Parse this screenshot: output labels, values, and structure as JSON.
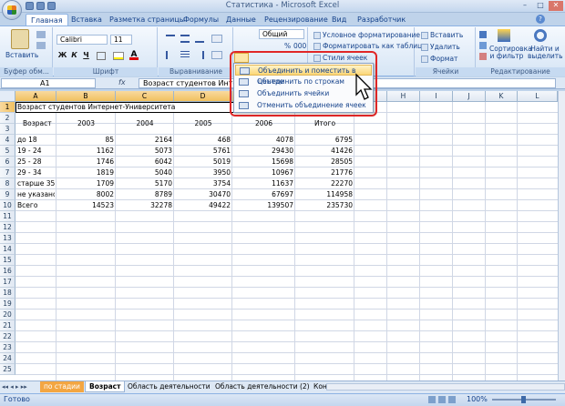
{
  "window": {
    "title": "Статистика - Microsoft Excel"
  },
  "ribbon": {
    "tabs": [
      "Главная",
      "Вставка",
      "Разметка страницы",
      "Формулы",
      "Данные",
      "Рецензирование",
      "Вид",
      "Разработчик"
    ],
    "active_tab": "Главная",
    "clipboard": {
      "paste": "Вставить",
      "label": "Буфер обм..."
    },
    "font": {
      "name": "Calibri",
      "size": "11",
      "bold": "Ж",
      "italic": "К",
      "underline": "Ч",
      "label": "Шрифт"
    },
    "alignment": {
      "label": "Выравнивание"
    },
    "number": {
      "format": "Общий",
      "percent": "%",
      "thousands": "000"
    },
    "styles": {
      "conditional": "Условное форматирование",
      "format_table": "Форматировать как таблицу",
      "cell_styles": "Стили ячеек"
    },
    "cells": {
      "insert": "Вставить",
      "delete": "Удалить",
      "format": "Формат",
      "label": "Ячейки"
    },
    "editing": {
      "sort": "Сортировка и фильтр",
      "find": "Найти и выделить",
      "label": "Редактирование"
    }
  },
  "formula_bar": {
    "name_box": "A1",
    "fx": "fx",
    "content": "Возраст студентов Интернет-Университета"
  },
  "merge_menu": {
    "items": [
      "Объединить и поместить в центре",
      "Объединить по строкам",
      "Объединить ячейки",
      "Отменить объединение ячеек"
    ]
  },
  "grid": {
    "columns": [
      "A",
      "B",
      "C",
      "D",
      "E",
      "F",
      "G",
      "H",
      "I",
      "J",
      "K",
      "L"
    ],
    "rows": [
      "1",
      "2",
      "3",
      "4",
      "5",
      "6",
      "7",
      "8",
      "9",
      "10",
      "11",
      "12",
      "13",
      "14",
      "15",
      "16",
      "17",
      "18",
      "19",
      "20",
      "21",
      "22",
      "23",
      "24",
      "25"
    ],
    "title": "Возраст студентов Интернет-Университета",
    "header": [
      "Возраст",
      "2003",
      "2004",
      "2005",
      "2006",
      "Итого"
    ],
    "data": [
      [
        "до 18",
        "85",
        "2164",
        "468",
        "4078",
        "6795"
      ],
      [
        "19 - 24",
        "1162",
        "5073",
        "5761",
        "29430",
        "41426"
      ],
      [
        "25 - 28",
        "1746",
        "6042",
        "5019",
        "15698",
        "28505"
      ],
      [
        "29 - 34",
        "1819",
        "5040",
        "3950",
        "10967",
        "21776"
      ],
      [
        "старше 35",
        "1709",
        "5170",
        "3754",
        "11637",
        "22270"
      ],
      [
        "не указано",
        "8002",
        "8789",
        "30470",
        "67697",
        "114958"
      ],
      [
        "Всего",
        "14523",
        "32278",
        "49422",
        "139507",
        "235730"
      ]
    ]
  },
  "sheets": {
    "tabs": [
      "по стадии",
      "Возраст",
      "Область деятельности",
      "Область деятельности (2)",
      "Кон"
    ],
    "active": "Возраст"
  },
  "status": {
    "ready": "Готово",
    "zoom": "100%"
  }
}
